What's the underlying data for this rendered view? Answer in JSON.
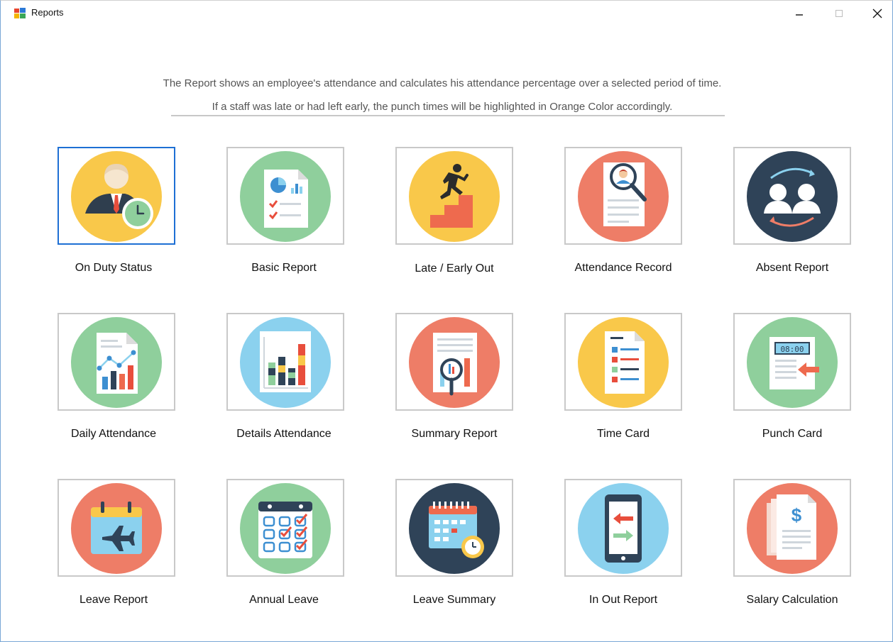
{
  "window": {
    "title": "Reports",
    "app_icon": "reports-app-icon",
    "controls": [
      "minimize-icon",
      "maximize-icon",
      "close-icon"
    ]
  },
  "intro": {
    "line1": "The Report shows an employee's attendance and calculates his attendance percentage over a selected period of time.",
    "line2": "If a staff was late or had left early, the punch times will be highlighted in Orange Color accordingly."
  },
  "reports": [
    {
      "label": "On Duty Status",
      "icon": "on-duty-icon",
      "color": "#f9c84a",
      "selected": true
    },
    {
      "label": "Basic Report",
      "icon": "basic-report-icon",
      "color": "#8fcf9c"
    },
    {
      "label": "Late / Early Out",
      "icon": "late-early-icon",
      "color": "#f9c84a"
    },
    {
      "label": "Attendance Record",
      "icon": "attendance-record-icon",
      "color": "#ee7d67"
    },
    {
      "label": "Absent Report",
      "icon": "absent-report-icon",
      "color": "#2f4358"
    },
    {
      "label": "Daily Attendance",
      "icon": "daily-attendance-icon",
      "color": "#8fcf9c"
    },
    {
      "label": "Details Attendance",
      "icon": "details-attendance-icon",
      "color": "#8bd1ee"
    },
    {
      "label": "Summary Report",
      "icon": "summary-report-icon",
      "color": "#ee7d67"
    },
    {
      "label": "Time Card",
      "icon": "time-card-icon",
      "color": "#f9c84a"
    },
    {
      "label": "Punch Card",
      "icon": "punch-card-icon",
      "color": "#8fcf9c",
      "display_time": "08:00"
    },
    {
      "label": "Leave Report",
      "icon": "leave-report-icon",
      "color": "#ee7d67"
    },
    {
      "label": "Annual Leave",
      "icon": "annual-leave-icon",
      "color": "#8fcf9c"
    },
    {
      "label": "Leave Summary",
      "icon": "leave-summary-icon",
      "color": "#2f4358"
    },
    {
      "label": "In Out Report",
      "icon": "in-out-report-icon",
      "color": "#8bd1ee"
    },
    {
      "label": "Salary Calculation",
      "icon": "salary-calculation-icon",
      "color": "#ee7d67",
      "symbol": "$"
    }
  ]
}
